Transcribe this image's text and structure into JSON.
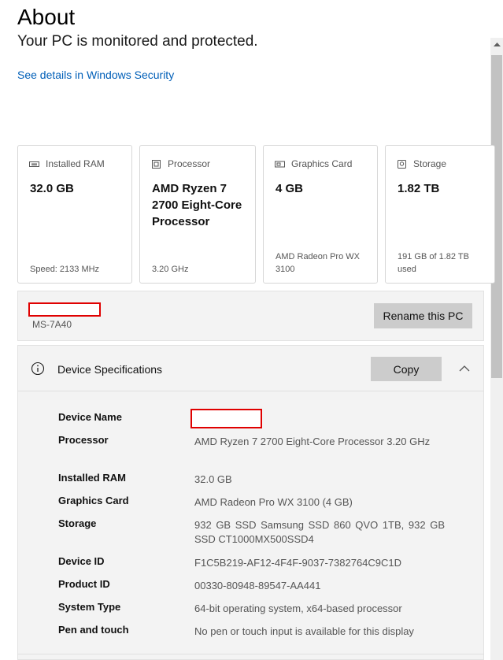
{
  "page": {
    "title": "About",
    "status": "Your PC is monitored and protected.",
    "security_link": "See details in Windows Security"
  },
  "cards": [
    {
      "icon": "ram-icon",
      "label": "Installed RAM",
      "value": "32.0 GB",
      "sub": "Speed: 2133 MHz"
    },
    {
      "icon": "processor-icon",
      "label": "Processor",
      "value": "AMD Ryzen 7 2700 Eight-Core Processor",
      "sub": "3.20 GHz"
    },
    {
      "icon": "graphics-card-icon",
      "label": "Graphics Card",
      "value": "4 GB",
      "sub": "AMD Radeon Pro WX 3100"
    },
    {
      "icon": "storage-icon",
      "label": "Storage",
      "value": "1.82 TB",
      "sub": "191 GB of 1.82 TB used"
    }
  ],
  "pc": {
    "model": "MS-7A40",
    "rename_label": "Rename this PC"
  },
  "specs": {
    "title": "Device Specifications",
    "copy_label": "Copy",
    "rows": [
      {
        "label": "Device Name",
        "value": ""
      },
      {
        "label": "Processor",
        "value": "AMD Ryzen 7 2700 Eight-Core Processor 3.20 GHz"
      },
      {
        "label": "Installed RAM",
        "value": "32.0 GB"
      },
      {
        "label": "Graphics Card",
        "value": "AMD Radeon Pro WX 3100 (4 GB)"
      },
      {
        "label": "Storage",
        "value": "932 GB SSD Samsung SSD 860 QVO 1TB, 932 GB SSD CT1000MX500SSD4"
      },
      {
        "label": "Device ID",
        "value": "F1C5B219-AF12-4F4F-9037-7382764C9C1D"
      },
      {
        "label": "Product ID",
        "value": "00330-80948-89547-AA441"
      },
      {
        "label": "System Type",
        "value": "64-bit operating system, x64-based processor"
      },
      {
        "label": "Pen and touch",
        "value": "No pen or touch input is available for this display"
      }
    ]
  },
  "colors": {
    "link": "#005fb8",
    "redaction": "#e00000",
    "panel": "#f3f3f3",
    "button": "#cccccc"
  }
}
